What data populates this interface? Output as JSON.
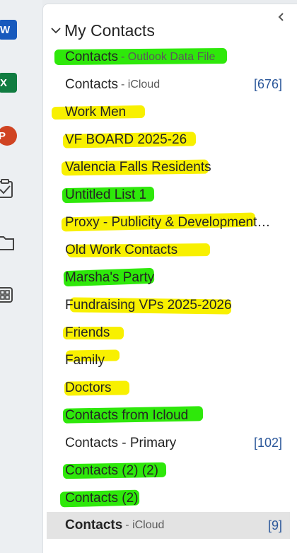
{
  "app_rail": {
    "word_letter": "W",
    "excel_letter": "X",
    "powerpoint_letter": "P"
  },
  "pane": {
    "title": "My Contacts"
  },
  "folders": [
    {
      "label": "Contacts",
      "sub": "- Outlook Data File",
      "count": ""
    },
    {
      "label": "Contacts",
      "sub": "- iCloud",
      "count": "[676]"
    },
    {
      "label": "Work Men",
      "sub": "",
      "count": ""
    },
    {
      "label": "VF BOARD 2025-26",
      "sub": "",
      "count": ""
    },
    {
      "label": "Valencia Falls Residents",
      "sub": "",
      "count": ""
    },
    {
      "label": "Untitled List 1",
      "sub": "",
      "count": ""
    },
    {
      "label": "Proxy - Publicity & Development…",
      "sub": "",
      "count": ""
    },
    {
      "label": "Old Work Contacts",
      "sub": "",
      "count": ""
    },
    {
      "label": "Marsha's Party",
      "sub": "",
      "count": ""
    },
    {
      "label": "Fundraising VPs 2025-2026",
      "sub": "",
      "count": ""
    },
    {
      "label": "Friends",
      "sub": "",
      "count": ""
    },
    {
      "label": "Family",
      "sub": "",
      "count": ""
    },
    {
      "label": "Doctors",
      "sub": "",
      "count": ""
    },
    {
      "label": "Contacts from Icloud",
      "sub": "",
      "count": ""
    },
    {
      "label": "Contacts -  Primary",
      "sub": "",
      "count": "[102]"
    },
    {
      "label": "Contacts (2) (2)",
      "sub": "",
      "count": ""
    },
    {
      "label": "Contacts (2)",
      "sub": "",
      "count": ""
    },
    {
      "label": "Contacts",
      "sub": "- iCloud",
      "count": "[9]"
    }
  ],
  "colors": {
    "highlight_green": "#2ee80a",
    "highlight_yellow": "#f8f000",
    "count_blue": "#2b579a",
    "selected_bg": "#e3e3e3"
  }
}
